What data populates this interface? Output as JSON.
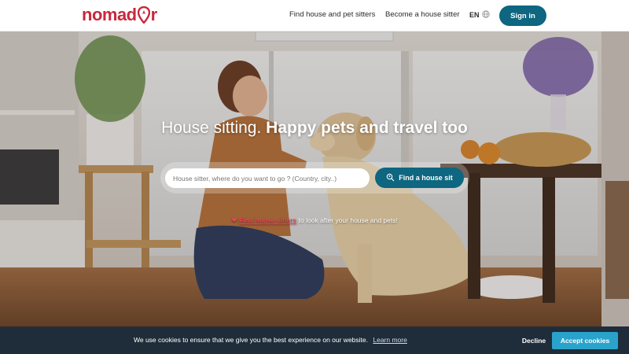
{
  "header": {
    "logo_text_left": "nomad",
    "logo_text_right": "r",
    "nav": {
      "find_sitters": "Find house and pet sitters",
      "become_sitter": "Become a house sitter"
    },
    "language": "EN",
    "signin_label": "Sign in"
  },
  "hero": {
    "title_light": "House sitting.",
    "title_bold": "Happy pets and travel too",
    "search": {
      "placeholder": "House sitter, where do you want to go ? (Country, city..)",
      "button_label": "Find a house sit"
    },
    "promo": {
      "link_text": "Find house sitters",
      "rest_text": "to look after your house and pets!"
    }
  },
  "cookie_bar": {
    "message": "We use cookies to ensure that we give you the best experience on our website.",
    "learn_more": "Learn more",
    "decline_label": "Decline",
    "accept_label": "Accept cookies"
  },
  "colors": {
    "brand": "#c8283c",
    "primary_button": "#0e6680",
    "cookie_bg": "#1f2d3a",
    "accept_button": "#2aa3cc",
    "promo_accent": "#e8425c"
  },
  "icons": {
    "language": "globe-icon",
    "search_button": "location-search-icon",
    "promo": "heart-icon",
    "logo_mark": "map-pin-icon"
  }
}
